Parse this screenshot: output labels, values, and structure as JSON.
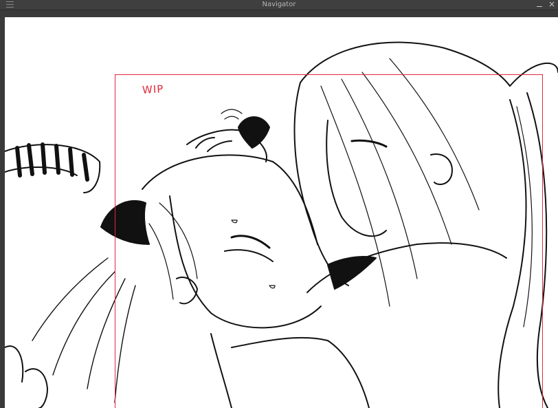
{
  "window": {
    "title": "Navigator",
    "close_glyph": "×"
  },
  "canvas": {
    "annotation": "WIP",
    "frame_color": "#e0283a",
    "background": "#ffffff"
  },
  "icons": [
    "menu-icon",
    "minimize-icon",
    "close-icon"
  ]
}
